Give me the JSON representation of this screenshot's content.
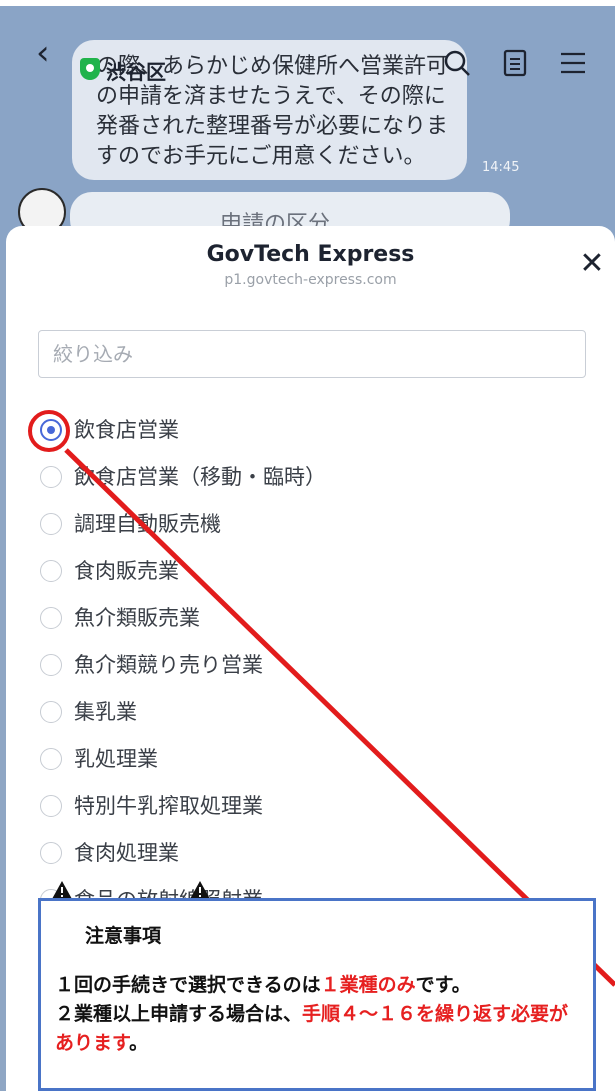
{
  "chat": {
    "title": "渋谷区",
    "message_text": "の際、あらかじめ保健所へ営業許可の申請を済ませたうえで、その際に発番された整理番号が必要になりますのでお手元にご用意ください。",
    "message_time": "14:45",
    "next_bubble_text": "申請の区分"
  },
  "modal": {
    "title": "GovTech Express",
    "url": "p1.govtech-express.com",
    "filter_placeholder": "絞り込み",
    "filter_value": "",
    "options": [
      {
        "label": "飲食店営業",
        "selected": true
      },
      {
        "label": "飲食店営業（移動・臨時）",
        "selected": false
      },
      {
        "label": "調理自動販売機",
        "selected": false
      },
      {
        "label": "食肉販売業",
        "selected": false
      },
      {
        "label": "魚介類販売業",
        "selected": false
      },
      {
        "label": "魚介類競り売り営業",
        "selected": false
      },
      {
        "label": "集乳業",
        "selected": false
      },
      {
        "label": "乳処理業",
        "selected": false
      },
      {
        "label": "特別牛乳搾取処理業",
        "selected": false
      },
      {
        "label": "食肉処理業",
        "selected": false
      },
      {
        "label": "食品の放射線照射業",
        "selected": false
      }
    ]
  },
  "notice": {
    "title": "注意事項",
    "line1_prefix": "１回の手続きで選択できるのは",
    "line1_red": "１業種のみ",
    "line1_suffix": "です。",
    "line2_prefix": "２業種以上申請する場合は、",
    "line2_red": "手順４～１６を繰り返す必要があります",
    "line2_suffix": "。"
  },
  "colors": {
    "accent_red": "#e21c1c",
    "radio_selected": "#4868d8",
    "notice_border": "#4a74c7"
  }
}
